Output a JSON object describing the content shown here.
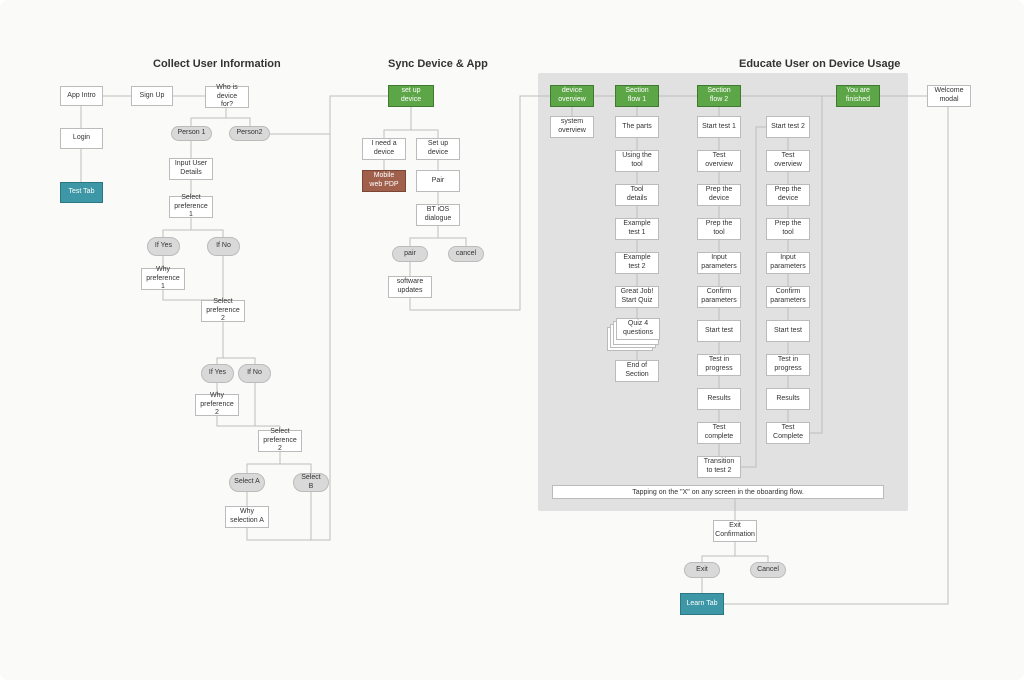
{
  "sections": {
    "collect": "Collect User Information",
    "sync": "Sync Device & App",
    "educate": "Educate User on Device Usage"
  },
  "collect": {
    "app_intro": "App Intro",
    "sign_up": "Sign Up",
    "who_for": "Who is device for?",
    "login": "Login",
    "test_tab": "Test Tab",
    "person1": "Person 1",
    "person2": "Person2",
    "input_details": "Input User Details",
    "select_pref1": "Select preference 1",
    "if_yes1": "If Yes",
    "if_no1": "If No",
    "why_pref1": "Why preference 1",
    "select_pref2a": "Select preference 2",
    "if_yes2": "If Yes",
    "if_no2": "If No",
    "why_pref2": "Why preference 2",
    "select_pref2b": "Select preference 2",
    "select_a": "Select A",
    "select_b": "Select B",
    "why_sel_a": "Why selection A"
  },
  "sync": {
    "setup_device": "set up device",
    "need_device": "I need a device",
    "setup_device2": "Set up device",
    "mobile_pdp": "Mobile web PDP",
    "pair": "Pair",
    "bt_dialogue": "BT iOS dialogue",
    "pair_btn": "pair",
    "cancel_btn": "cancel",
    "sw_updates": "software updates"
  },
  "educate": {
    "device_overview": "device overview",
    "system_overview": "system overview",
    "section_flow1": "Section flow 1",
    "section_flow2": "Section flow 2",
    "you_finished": "You are finished",
    "welcome_modal": "Welcome modal",
    "flow1": {
      "parts": "The parts",
      "using_tool": "Using the tool",
      "tool_details": "Tool details",
      "example1": "Example test 1",
      "example2": "Example test 2",
      "great_job": "Great Job! Start Quiz",
      "quiz": "Quiz 4 questions",
      "end_section": "End of Section"
    },
    "flow2a": {
      "start_test1": "Start test 1",
      "test_overview": "Test overview",
      "prep_device": "Prep the device",
      "prep_tool": "Prep the tool",
      "input_params": "Input parameters",
      "confirm_params": "Confirm parameters",
      "start_test": "Start test",
      "in_progress": "Test in progress",
      "results": "Results",
      "complete": "Test complete",
      "transition": "Transition to test 2"
    },
    "flow2b": {
      "start_test2": "Start test 2",
      "test_overview": "Test overview",
      "prep_device": "Prep the device",
      "prep_tool": "Prep the tool",
      "input_params": "Input parameters",
      "confirm_params": "Confirm parameters",
      "start_test": "Start test",
      "in_progress": "Test in progress",
      "results": "Results",
      "complete": "Test Complete"
    },
    "tap_note": "Tapping on the \"X\" on any screen in the oboarding flow.",
    "exit_confirm": "Exit Confirmation",
    "exit": "Exit",
    "cancel": "Cancel",
    "learn_tab": "Learn Tab"
  },
  "colors": {
    "green": "#5da648",
    "teal": "#3d97a6",
    "brown": "#a0604c",
    "pill": "#d9d9d9",
    "educate_bg": "#e1e1e1"
  }
}
